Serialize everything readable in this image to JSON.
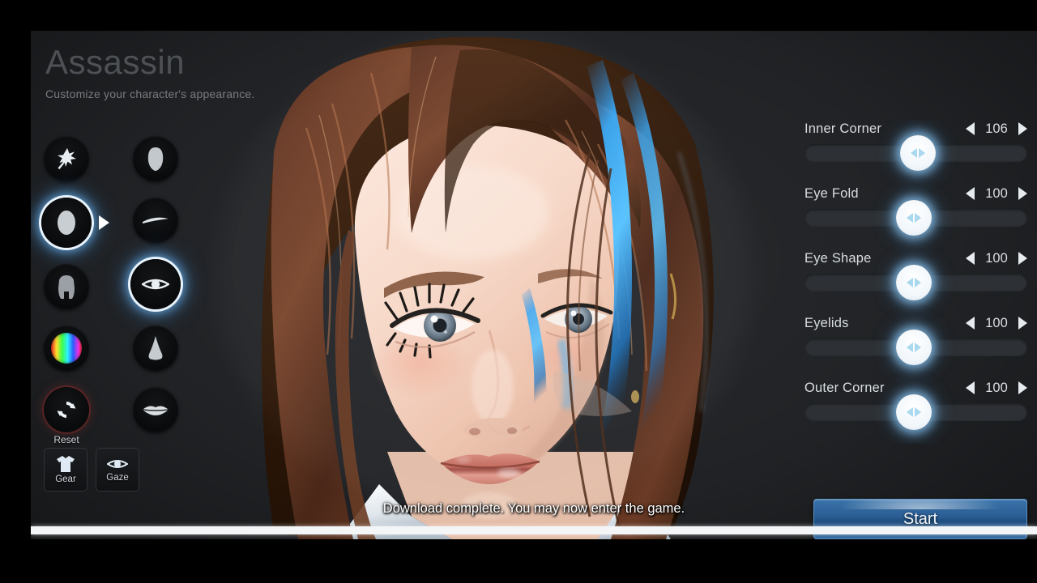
{
  "header": {
    "title": "Assassin",
    "subtitle": "Customize your character's appearance."
  },
  "colors": {
    "background": "#212326",
    "letterbox": "#000000",
    "accent_glow": "#7cc3ff",
    "start_button": "#2a5c92",
    "text_primary": "#d9dde1",
    "title_text": "#4d5054",
    "knob": "#ffffff",
    "track": "#2d3135",
    "progress_fill": "#f3f5f7"
  },
  "left_rail": {
    "primary": [
      {
        "name": "preset-wand",
        "icon": "magic-wand-icon",
        "selected": false,
        "label": ""
      },
      {
        "name": "face",
        "icon": "face-head-icon",
        "selected": true,
        "label": ""
      },
      {
        "name": "body",
        "icon": "body-torso-icon",
        "selected": false,
        "label": ""
      },
      {
        "name": "color",
        "icon": "color-wheel-icon",
        "selected": false,
        "label": ""
      },
      {
        "name": "reset",
        "icon": "reset-refresh-icon",
        "selected": false,
        "label": "Reset"
      }
    ],
    "secondary": [
      {
        "name": "head-shape",
        "icon": "head-silhouette-icon",
        "selected": false
      },
      {
        "name": "eyebrows",
        "icon": "eyebrow-icon",
        "selected": false
      },
      {
        "name": "eyes",
        "icon": "eye-icon",
        "selected": true
      },
      {
        "name": "nose",
        "icon": "nose-icon",
        "selected": false
      },
      {
        "name": "lips",
        "icon": "lips-icon",
        "selected": false
      }
    ]
  },
  "bottom_buttons": [
    {
      "name": "gear",
      "label": "Gear",
      "icon": "shirt-icon"
    },
    {
      "name": "gaze",
      "label": "Gaze",
      "icon": "eye-icon"
    }
  ],
  "sliders": [
    {
      "label": "Inner Corner",
      "value": "106",
      "percent": 51
    },
    {
      "label": "Eye Fold",
      "value": "100",
      "percent": 49
    },
    {
      "label": "Eye Shape",
      "value": "100",
      "percent": 49
    },
    {
      "label": "Eyelids",
      "value": "100",
      "percent": 49
    },
    {
      "label": "Outer Corner",
      "value": "100",
      "percent": 49
    }
  ],
  "arrows": {
    "decrement": "◀",
    "increment": "▶"
  },
  "start": {
    "label": "Start"
  },
  "status": {
    "message": "Download complete. You may now enter the game.",
    "progress_percent": 100
  }
}
